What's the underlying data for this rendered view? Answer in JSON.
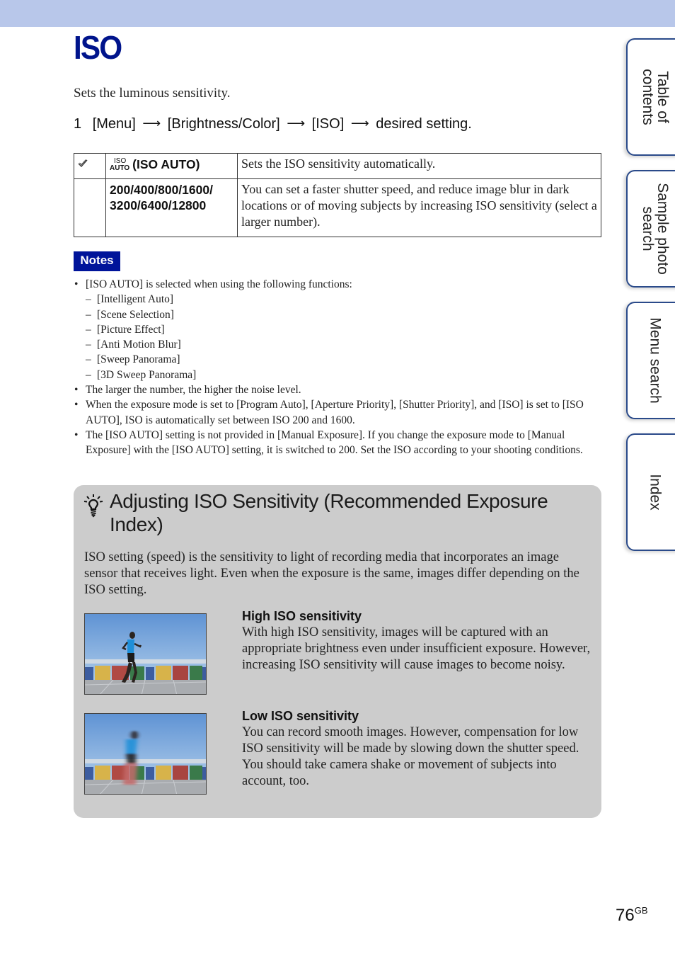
{
  "page": {
    "title": "ISO",
    "intro": "Sets the luminous sensitivity.",
    "step": {
      "number": "1",
      "parts": [
        "[Menu]",
        "[Brightness/Color]",
        "[ISO]",
        "desired setting."
      ],
      "arrow_icon": "right-arrow-icon"
    },
    "settings_table": [
      {
        "default_marker": "checkmark-icon",
        "icon_top": "ISO",
        "icon_bottom": "AUTO",
        "option": "(ISO AUTO)",
        "description": "Sets the ISO sensitivity automatically."
      },
      {
        "default_marker": "",
        "option_line1": "200/400/800/1600/",
        "option_line2": "3200/6400/12800",
        "description": "You can set a faster shutter speed, and reduce image blur in dark locations or of moving subjects by increasing ISO sensitivity (select a larger number)."
      }
    ],
    "notes": {
      "badge": "Notes",
      "items": [
        {
          "text": "[ISO AUTO] is selected when using the following functions:",
          "sub": [
            "[Intelligent Auto]",
            "[Scene Selection]",
            "[Picture Effect]",
            "[Anti Motion Blur]",
            "[Sweep Panorama]",
            "[3D Sweep Panorama]"
          ]
        },
        {
          "text": "The larger the number, the higher the noise level."
        },
        {
          "text": "When the exposure mode is set to [Program Auto], [Aperture Priority], [Shutter Priority], and [ISO] is set to [ISO AUTO], ISO is automatically set between ISO 200 and 1600."
        },
        {
          "text": "The [ISO AUTO] setting is not provided in [Manual Exposure]. If you change the exposure mode to [Manual Exposure] with the [ISO AUTO] setting, it is switched to 200. Set the ISO according to your shooting conditions."
        }
      ]
    },
    "tip": {
      "icon": "lightbulb-hint-icon",
      "title": "Adjusting ISO Sensitivity (Recommended Exposure Index)",
      "body": "ISO setting (speed) is the sensitivity to light of recording media that incorporates an image sensor that receives light. Even when the exposure is the same, images differ depending on the ISO setting.",
      "items": [
        {
          "heading": "High ISO sensitivity",
          "text": "With high ISO sensitivity, images will be captured with an appropriate brightness even under insufficient exposure. However, increasing ISO sensitivity will cause images to become noisy.",
          "photo": "runner-sharp-photo"
        },
        {
          "heading": "Low ISO sensitivity",
          "text": "You can record smooth images. However, compensation for low ISO sensitivity will be made by slowing down the shutter speed. You should take camera shake or movement of subjects into account, too.",
          "photo": "runner-blurred-photo"
        }
      ]
    },
    "page_number": "76",
    "page_suffix": "GB"
  },
  "side_tabs": [
    {
      "label": "Table of\ncontents"
    },
    {
      "label": "Sample photo\nsearch"
    },
    {
      "label": "Menu search"
    },
    {
      "label": "Index"
    }
  ],
  "colors": {
    "title_blue": "#00148c",
    "notes_badge": "#00149a",
    "top_band": "#b8c7ea",
    "tip_box": "#cccccc",
    "tab_border": "#2a4a8a"
  }
}
